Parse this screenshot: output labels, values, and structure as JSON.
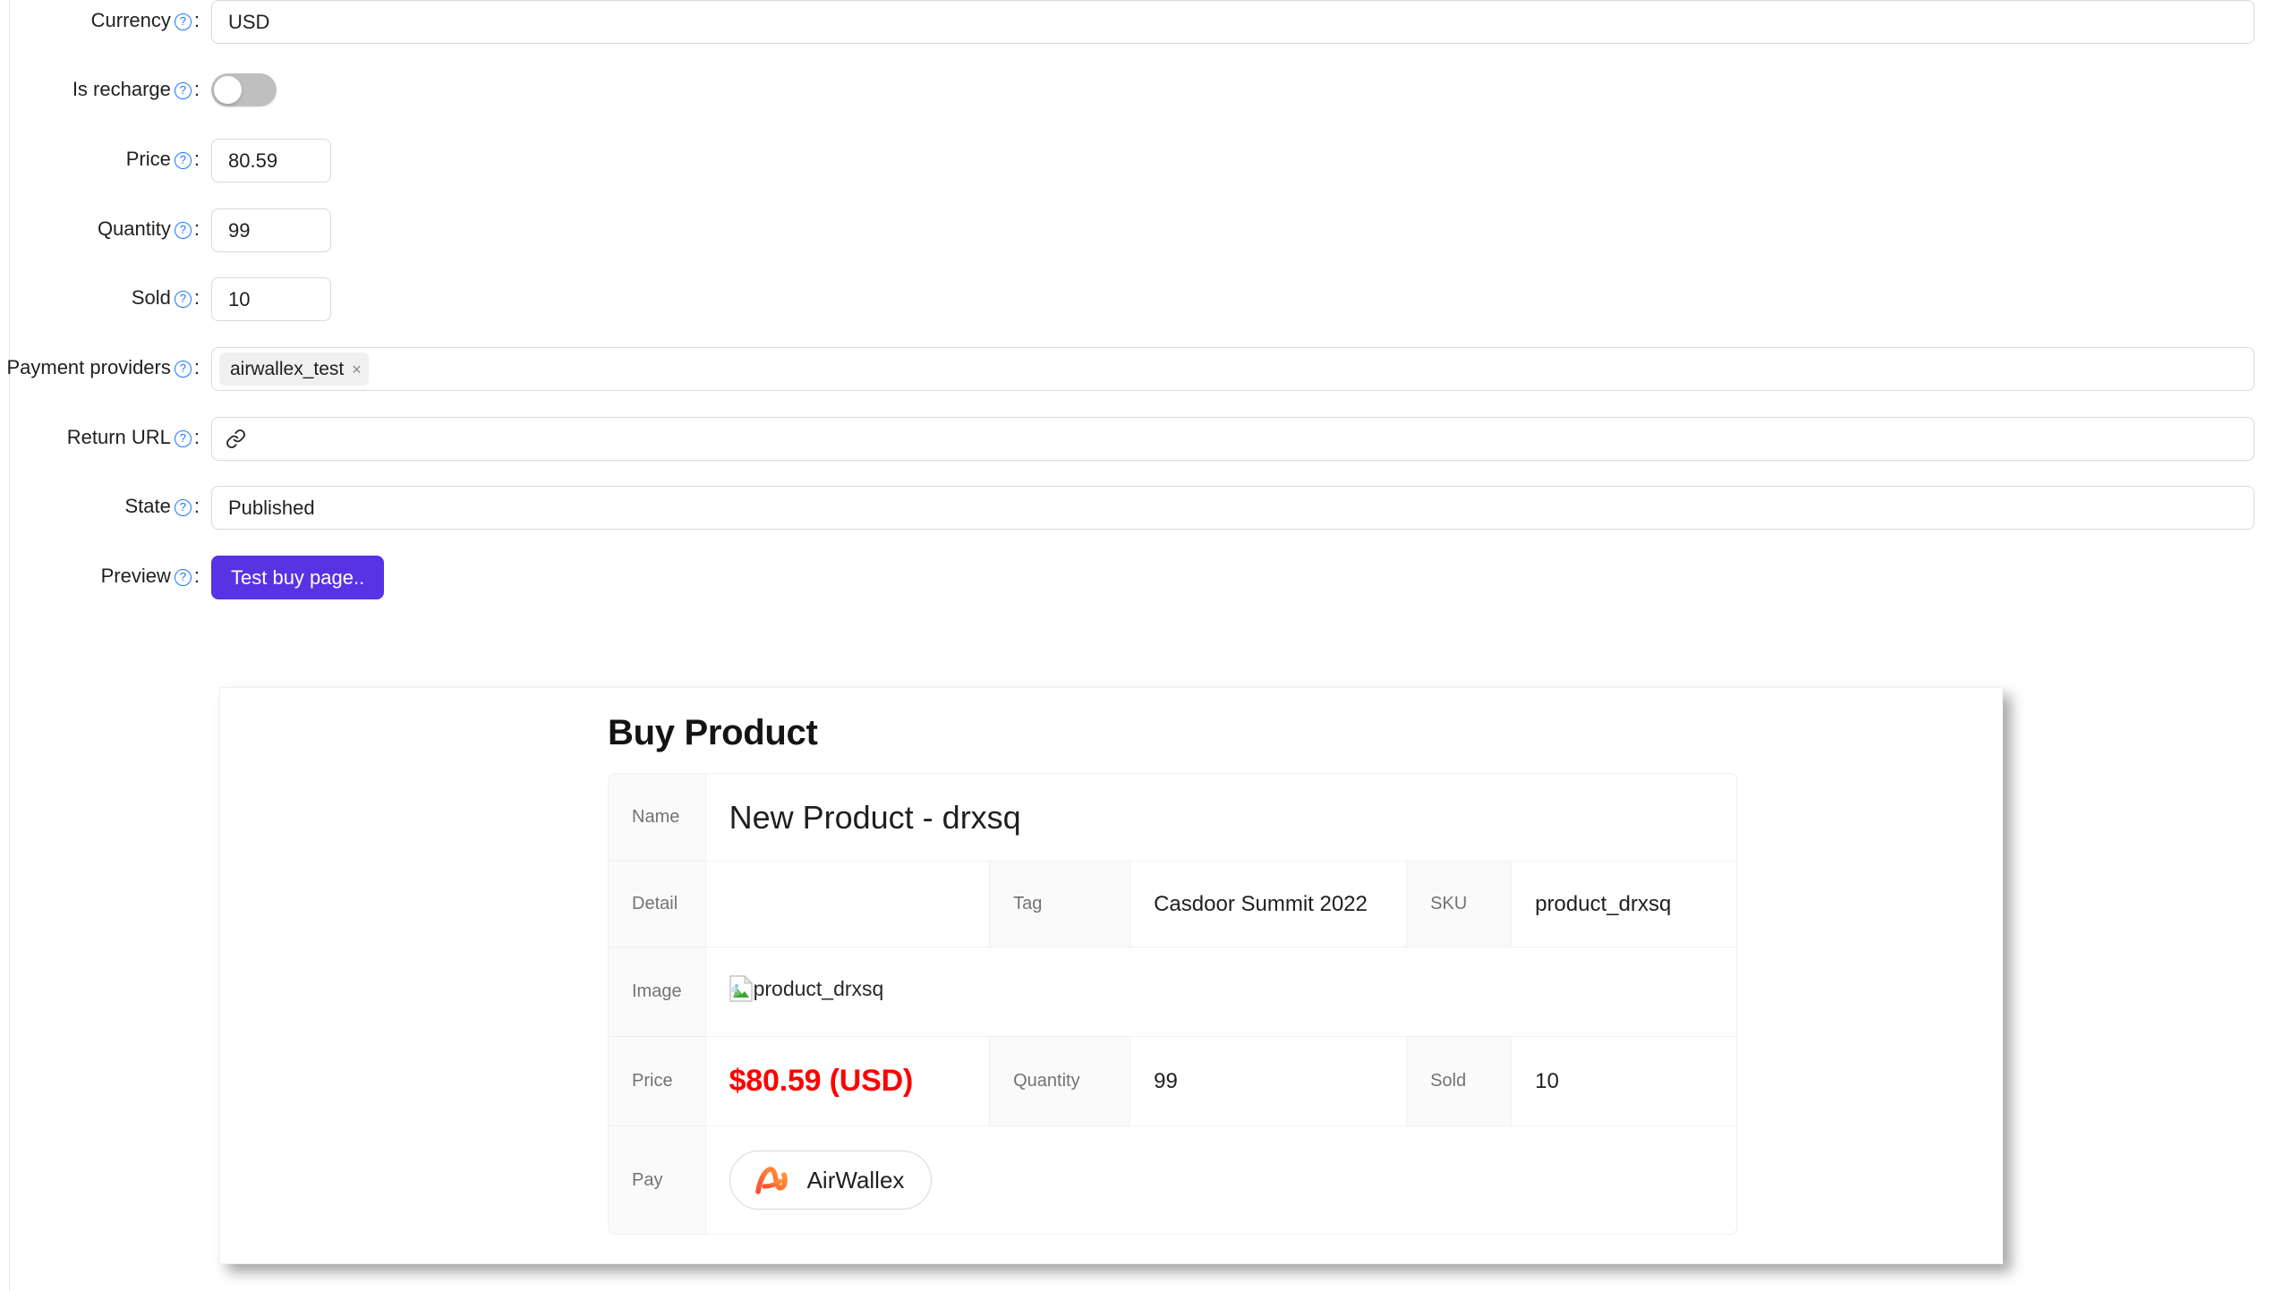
{
  "form": {
    "rows": [
      {
        "label": "Currency",
        "help_icon": "question-circle-icon",
        "colon": ":",
        "type": "input",
        "value": "USD"
      },
      {
        "label": "Is recharge",
        "help_icon": "question-circle-icon",
        "colon": ":",
        "type": "switch",
        "value": "off"
      },
      {
        "label": "Price",
        "help_icon": "question-circle-icon",
        "colon": ":",
        "type": "input-small",
        "value": "80.59"
      },
      {
        "label": "Quantity",
        "help_icon": "question-circle-icon",
        "colon": ":",
        "type": "input-small",
        "value": "99"
      },
      {
        "label": "Sold",
        "help_icon": "question-circle-icon",
        "colon": ":",
        "type": "input-small",
        "value": "10"
      },
      {
        "label": "Payment providers",
        "help_icon": "question-circle-icon",
        "colon": ":",
        "type": "select-multi",
        "tags": [
          "airwallex_test"
        ],
        "tag_close": "×"
      },
      {
        "label": "Return URL",
        "help_icon": "question-circle-icon",
        "colon": ":",
        "type": "input-link",
        "value": "",
        "placeholder": "",
        "prefix_icon": "link-icon"
      },
      {
        "label": "State",
        "help_icon": "question-circle-icon",
        "colon": ":",
        "type": "input",
        "value": "Published"
      },
      {
        "label": "Preview",
        "help_icon": "question-circle-icon",
        "colon": ":",
        "type": "button",
        "button_label": "Test buy page.."
      }
    ]
  },
  "preview": {
    "title": "Buy Product",
    "rows": {
      "name": {
        "label": "Name",
        "value": "New Product - drxsq"
      },
      "detail": {
        "label": "Detail",
        "value": "",
        "tag_label": "Tag",
        "tag_value": "Casdoor Summit 2022",
        "sku_label": "SKU",
        "sku_value": "product_drxsq"
      },
      "image": {
        "label": "Image",
        "alt_text": "product_drxsq",
        "icon": "broken-image-icon"
      },
      "price": {
        "label": "Price",
        "value": "$80.59 (USD)",
        "quantity_label": "Quantity",
        "quantity_value": "99",
        "sold_label": "Sold",
        "sold_value": "10"
      },
      "pay": {
        "label": "Pay",
        "provider_label": "AirWallex",
        "provider_icon": "airwallex-logo-icon"
      }
    }
  },
  "colors": {
    "primary_button": "#5733e3",
    "price_red": "#ff0000",
    "help_blue": "#1677ff",
    "switch_off": "#bfbfbf",
    "airwallex_orange": "#ff5b33"
  }
}
